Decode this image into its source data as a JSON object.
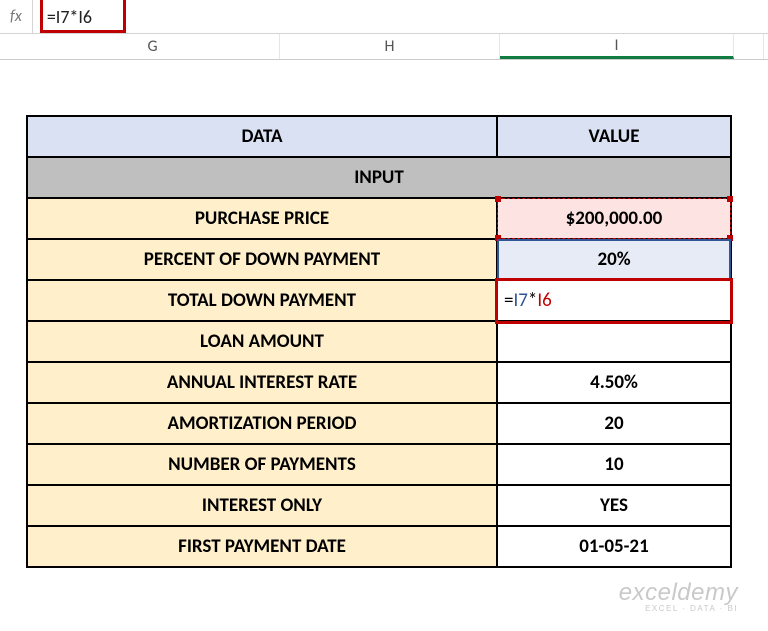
{
  "formula_bar": {
    "fx_label": "fx",
    "formula": "=I7*I6"
  },
  "columns": {
    "g": "G",
    "h": "H",
    "i": "I"
  },
  "headers": {
    "data": "DATA",
    "value": "VALUE"
  },
  "section": "INPUT",
  "rows": {
    "purchase_price": {
      "label": "PURCHASE PRICE",
      "value": "$200,000.00"
    },
    "percent_down": {
      "label": "PERCENT OF DOWN PAYMENT",
      "value": "20%"
    },
    "total_down": {
      "label": "TOTAL DOWN PAYMENT",
      "formula_display": {
        "ref1": "I7",
        "ref2": "I6"
      }
    },
    "loan_amount": {
      "label": "LOAN AMOUNT",
      "value": ""
    },
    "annual_rate": {
      "label": "ANNUAL INTEREST RATE",
      "value": "4.50%"
    },
    "amort_period": {
      "label": "AMORTIZATION PERIOD",
      "value": "20"
    },
    "num_payments": {
      "label": "NUMBER OF PAYMENTS",
      "value": "10"
    },
    "interest_only": {
      "label": "INTEREST ONLY",
      "value": "YES"
    },
    "first_payment": {
      "label": "FIRST PAYMENT DATE",
      "value": "01-05-21"
    }
  },
  "watermark": {
    "line1": "exceldemy",
    "line2": "EXCEL · DATA · BI"
  }
}
